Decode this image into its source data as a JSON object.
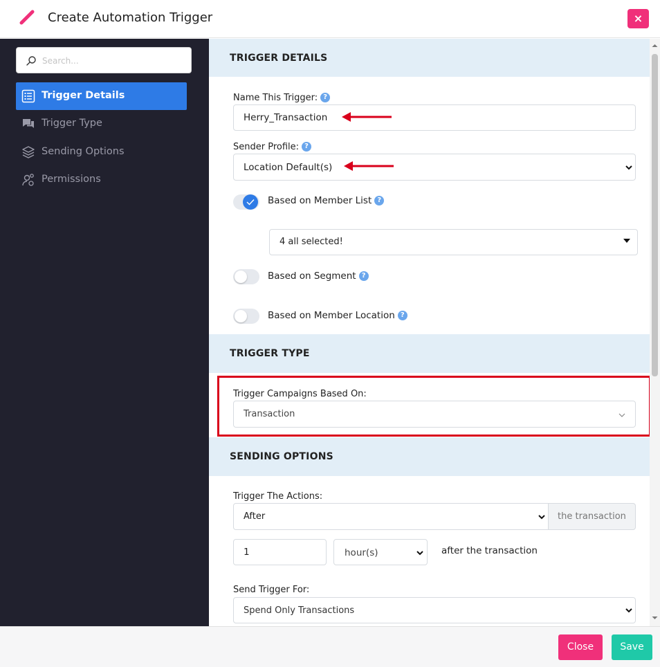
{
  "header": {
    "title": "Create Automation Trigger",
    "close_x": "×",
    "icon": "pencil-icon"
  },
  "sidebar": {
    "search_placeholder": "Search...",
    "items": [
      {
        "label": "Trigger Details",
        "icon": "list-icon",
        "active": true
      },
      {
        "label": "Trigger Type",
        "icon": "chat-icon",
        "active": false
      },
      {
        "label": "Sending Options",
        "icon": "layers-icon",
        "active": false
      },
      {
        "label": "Permissions",
        "icon": "user-gear-icon",
        "active": false
      }
    ]
  },
  "trigger_details": {
    "heading": "TRIGGER DETAILS",
    "name_label": "Name This Trigger:",
    "name_value": "Herry_Transaction",
    "sender_label": "Sender Profile:",
    "sender_value": "Location Default(s)",
    "member_list_label": "Based on Member List",
    "member_list_on": true,
    "member_list_select": "4 all selected!",
    "segment_label": "Based on Segment",
    "segment_on": false,
    "location_label": "Based on Member Location",
    "location_on": false
  },
  "trigger_type": {
    "heading": "TRIGGER TYPE",
    "campaigns_label": "Trigger Campaigns Based On:",
    "campaigns_value": "Transaction"
  },
  "sending_options": {
    "heading": "SENDING OPTIONS",
    "actions_label": "Trigger The Actions:",
    "actions_value": "After",
    "actions_suffix": "the transaction",
    "delay_value": "1",
    "delay_unit": "hour(s)",
    "delay_suffix": "after the transaction",
    "send_for_label": "Send Trigger For:",
    "send_for_value": "Spend Only Transactions"
  },
  "help_glyph": "?",
  "footer": {
    "close_label": "Close",
    "save_label": "Save"
  },
  "colors": {
    "accent": "#2e7be6",
    "pink": "#f0307a",
    "teal": "#1fc9a8",
    "annotation_red": "#d9001b",
    "sidebar_bg": "#21212e",
    "section_bg": "#e2eef7"
  }
}
